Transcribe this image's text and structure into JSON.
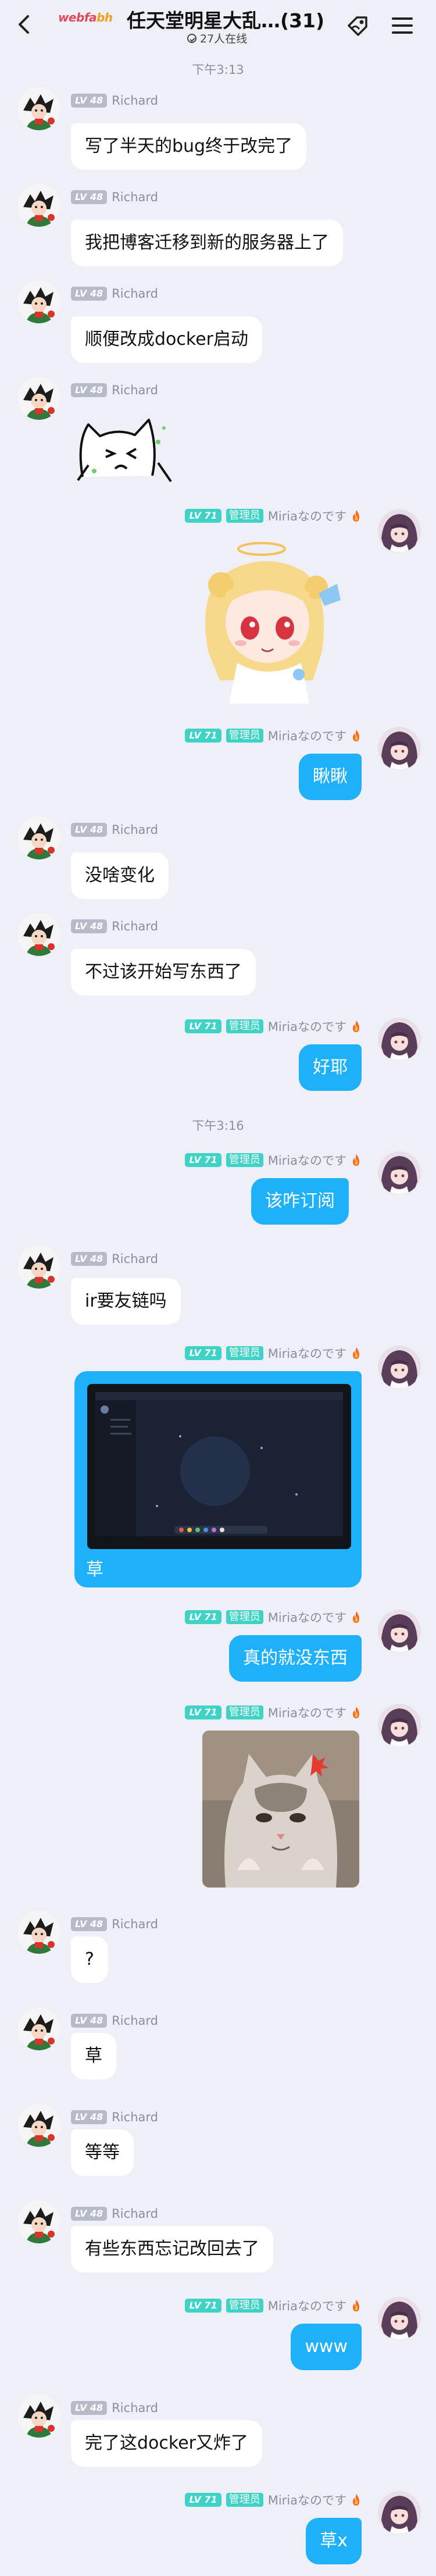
{
  "header": {
    "logo_text_1": "webfa",
    "logo_text_2": "bh",
    "title": "任天堂明星大乱…(31)",
    "online": "27人在线"
  },
  "colors": {
    "incoming_bubble": "#ffffff",
    "outgoing_bubble": "#1eb1fa",
    "admin_badge": "#3fd2c6",
    "level_badge": "#b7bac7",
    "background": "#eff0f7"
  },
  "users": {
    "richard": {
      "name": "Richard",
      "level": "LV 48"
    },
    "miria": {
      "name": "Miriaなのです",
      "level": "LV 71",
      "role": "管理员"
    }
  },
  "times": [
    "下午3:13",
    "下午3:16"
  ],
  "messages": [
    {
      "text": "写了半天的bug终于改完了"
    },
    {
      "text": "我把博客迁移到新的服务器上了"
    },
    {
      "text": "顺便改成docker启动"
    },
    {
      "sticker": "cat-sticker"
    },
    {
      "sticker": "anime-girl-sticker"
    },
    {
      "text": "瞅瞅"
    },
    {
      "text": "没啥变化"
    },
    {
      "text": "不过该开始写东西了"
    },
    {
      "text": "好耶"
    },
    {
      "text": "该咋订阅"
    },
    {
      "text": "ir要友链吗"
    },
    {
      "text": "草",
      "image": "screenshot-image"
    },
    {
      "text": "真的就没东西"
    },
    {
      "sticker": "angry-cat-photo"
    },
    {
      "text": "?"
    },
    {
      "text": "草"
    },
    {
      "text": "等等"
    },
    {
      "text": "有些东西忘记改回去了"
    },
    {
      "text": "www"
    },
    {
      "text": "完了这docker又炸了"
    },
    {
      "text": "草x"
    }
  ]
}
